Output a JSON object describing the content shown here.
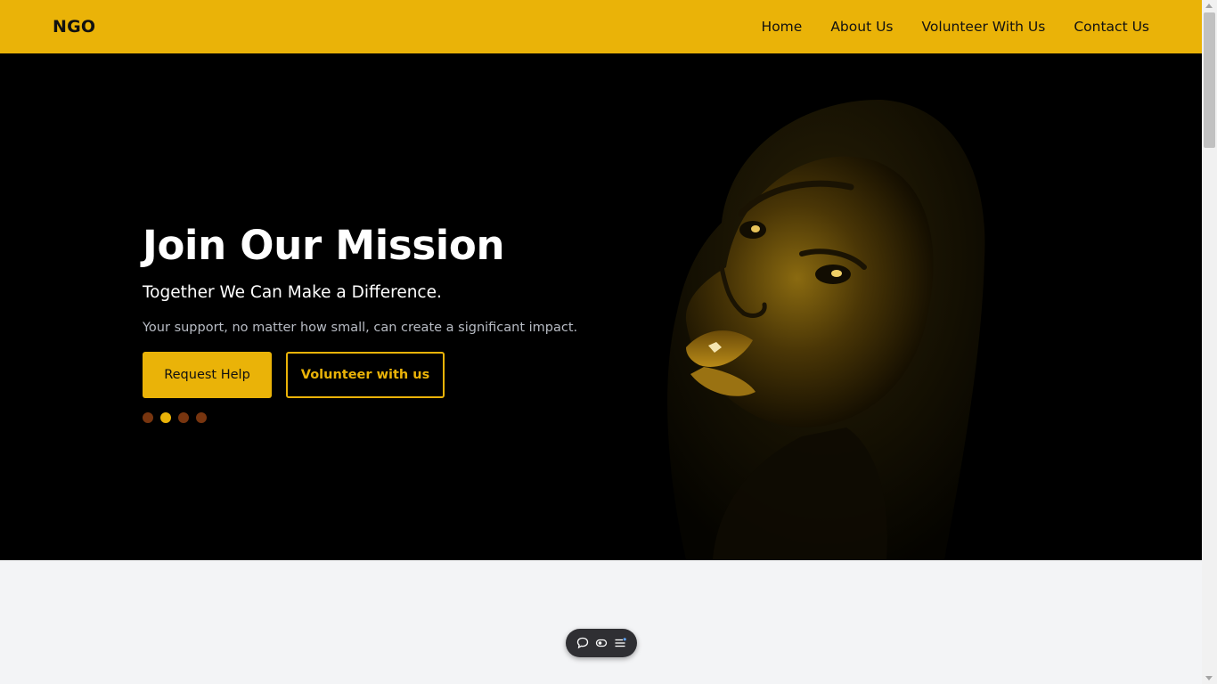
{
  "navbar": {
    "brand": "NGO",
    "links": [
      {
        "label": "Home"
      },
      {
        "label": "About Us"
      },
      {
        "label": "Volunteer With Us"
      },
      {
        "label": "Contact Us"
      }
    ]
  },
  "hero": {
    "title": "Join Our Mission",
    "subtitle": "Together We Can Make a Difference.",
    "description": "Your support, no matter how small, can create a significant impact.",
    "primary_button": "Request Help",
    "secondary_button": "Volunteer with us",
    "carousel": {
      "slide_count": 4,
      "active_index": 1
    }
  },
  "floating_toolbar": {
    "icons": [
      "chat-bubble-icon",
      "eye-toggle-icon",
      "menu-lines-icon"
    ]
  },
  "colors": {
    "accent": "#eab308",
    "hero_background": "#000000",
    "page_background": "#f3f4f6",
    "inactive_dot": "#78350f"
  }
}
